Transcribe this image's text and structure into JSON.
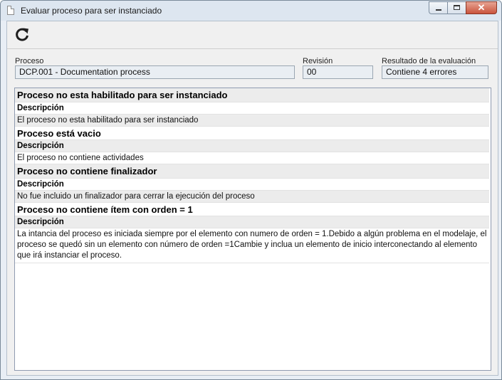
{
  "window": {
    "title": "Evaluar proceso para ser instanciado",
    "close_glyph": "✕"
  },
  "toolbar": {
    "refresh_icon": "refresh-icon"
  },
  "fields": {
    "proceso": {
      "label": "Proceso",
      "value": "DCP.001 - Documentation process"
    },
    "revision": {
      "label": "Revisión",
      "value": "00"
    },
    "resultado": {
      "label": "Resultado de la evaluación",
      "value": "Contiene 4 errores"
    }
  },
  "errors": [
    {
      "title": "Proceso no esta habilitado para ser instanciado",
      "desc_label": "Descripción",
      "desc": "El proceso no esta habilitado para ser instanciado"
    },
    {
      "title": "Proceso está vacio",
      "desc_label": "Descripción",
      "desc": "El proceso no contiene actividades"
    },
    {
      "title": "Proceso no contiene finalizador",
      "desc_label": "Descripción",
      "desc": "No fue incluido un finalizador para cerrar la ejecución del proceso"
    },
    {
      "title": "Proceso no contiene ítem con orden = 1",
      "desc_label": "Descripción",
      "desc": "La intancia del proceso es iniciada siempre por el elemento con numero de orden = 1.Debido a algún problema en el modelaje, el proceso se quedó sin un elemento con número de orden =1Cambie y inclua un elemento de inicio interconectando al elemento que irá instanciar el proceso."
    }
  ]
}
